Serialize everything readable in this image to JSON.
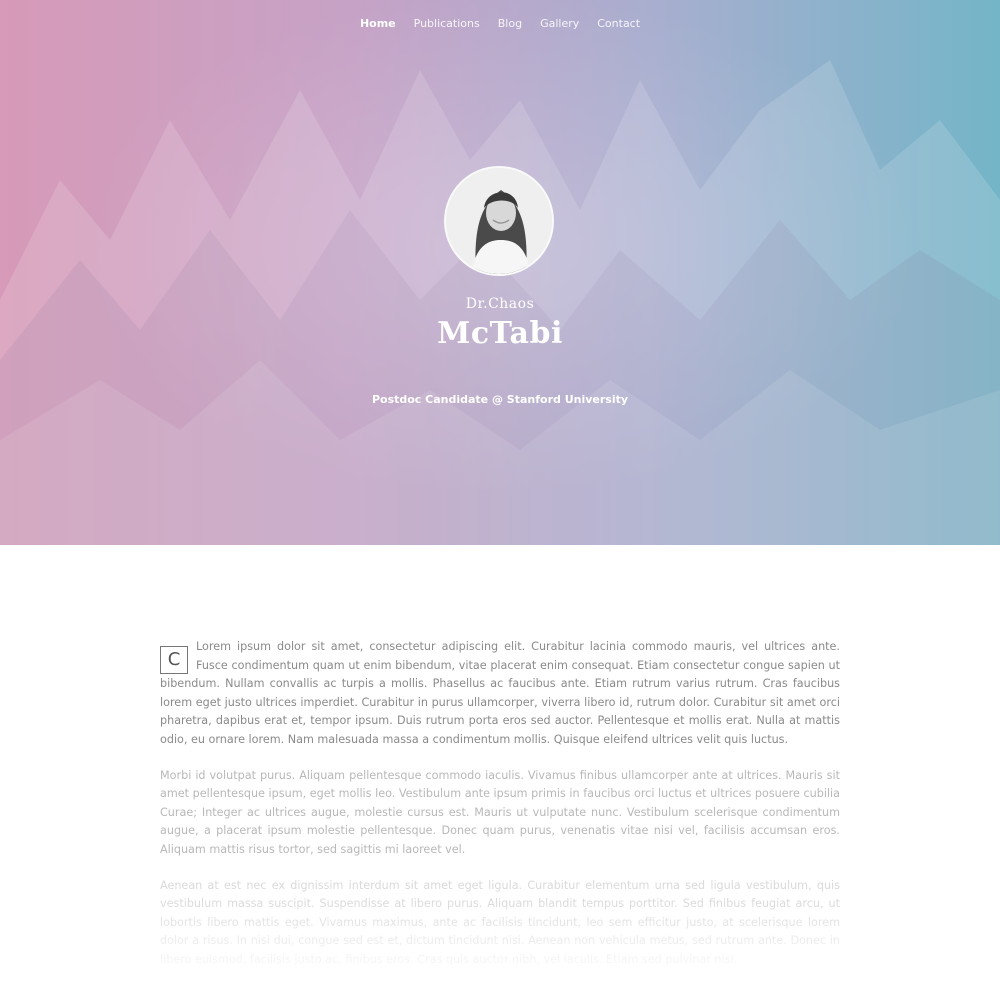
{
  "nav": {
    "items": [
      {
        "label": "Home",
        "active": true
      },
      {
        "label": "Publications",
        "active": false
      },
      {
        "label": "Blog",
        "active": false
      },
      {
        "label": "Gallery",
        "active": false
      },
      {
        "label": "Contact",
        "active": false
      }
    ]
  },
  "profile": {
    "first_name": "Dr.Chaos",
    "last_name": "McTabi",
    "tagline": "Postdoc Candidate @ Stanford University"
  },
  "content": {
    "dropcap": "C",
    "paragraphs": [
      "Lorem ipsum dolor sit amet, consectetur adipiscing elit. Curabitur lacinia commodo mauris, vel ultrices ante. Fusce condimentum quam ut enim bibendum, vitae placerat enim consequat. Etiam consectetur congue sapien ut bibendum. Nullam convallis ac turpis a mollis. Phasellus ac faucibus ante. Etiam rutrum varius rutrum. Cras faucibus lorem eget justo ultrices imperdiet. Curabitur in purus ullamcorper, viverra libero id, rutrum dolor. Curabitur sit amet orci pharetra, dapibus erat et, tempor ipsum. Duis rutrum porta eros sed auctor. Pellentesque et mollis erat. Nulla at mattis odio, eu ornare lorem. Nam malesuada massa a condimentum mollis. Quisque eleifend ultrices velit quis luctus.",
      "Morbi id volutpat purus. Aliquam pellentesque commodo iaculis. Vivamus finibus ullamcorper ante at ultrices. Mauris sit amet pellentesque ipsum, eget mollis leo. Vestibulum ante ipsum primis in faucibus orci luctus et ultrices posuere cubilia Curae; Integer ac ultrices augue, molestie cursus est. Mauris ut vulputate nunc. Vestibulum scelerisque condimentum augue, a placerat ipsum molestie pellentesque. Donec quam purus, venenatis vitae nisi vel, facilisis accumsan eros. Aliquam mattis risus tortor, sed sagittis mi laoreet vel.",
      "Aenean at est nec ex dignissim interdum sit amet eget ligula. Curabitur elementum urna sed ligula vestibulum, quis vestibulum massa suscipit. Suspendisse at libero purus. Aliquam blandit tempus porttitor. Sed finibus feugiat arcu, ut lobortis libero mattis eget. Vivamus maximus, ante ac facilisis tincidunt, leo sem efficitur justo, at scelerisque lorem dolor a risus. In nisi dui, congue sed est et, dictum tincidunt nisi. Aenean non vehicula metus, sed rutrum ante. Donec in libero euismod, facilisis justo ac, finibus eros. Cras quis auctor nibh, vel iaculis. Etiam sed pulvinar nisi."
    ]
  },
  "colors": {
    "hero_left": "#d79ab8",
    "hero_mid": "#a9aecf",
    "hero_right": "#74b5c8",
    "body_text": "#8a8a8a"
  }
}
